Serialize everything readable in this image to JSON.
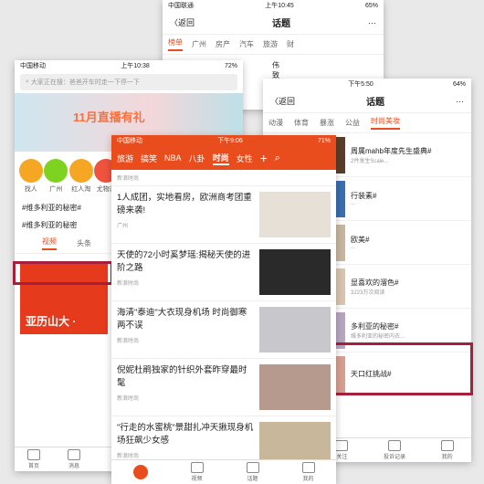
{
  "phone_back": {
    "status": {
      "carrier": "中国联通",
      "time": "上午10:45",
      "battery": "65%"
    },
    "nav": {
      "back": "〈返回",
      "title": "话题",
      "more": "···"
    },
    "tabs": [
      "榜单",
      "广州",
      "房产",
      "汽车",
      "旅游",
      "财"
    ],
    "preview": "伟致11  作日投年"
  },
  "phone_right": {
    "status": {
      "carrier": "",
      "time": "下午5:50",
      "battery": "64%"
    },
    "nav": {
      "back": "〈返回",
      "title": "话题",
      "more": "···"
    },
    "tabs": [
      "动漫",
      "体育",
      "暴涨",
      "公益",
      "时尚美妆"
    ],
    "items": [
      {
        "title": "周属mahb年度先生盛典#",
        "sub": "2件发生Scale..."
      },
      {
        "title": "行装素#",
        "sub": "..."
      },
      {
        "title": "欧美#",
        "sub": "..."
      },
      {
        "title": "显喜欢的溜色#",
        "sub": "3223万次阅读"
      },
      {
        "title": "多利亚的秘密#",
        "sub": "维多利亚的秘密内衣..."
      },
      {
        "title": "天口红挑战#",
        "sub": ""
      }
    ],
    "tabbar": [
      "关注",
      "投诉记录",
      "我的"
    ]
  },
  "phone_left": {
    "status": {
      "carrier": "中国移动",
      "time": "上午10:38",
      "battery": "72%"
    },
    "search_placeholder": "大家正在搜：爸爸开车时走一下停一下",
    "banner_text": "11月直播有礼",
    "icons": [
      {
        "label": "找人",
        "color": "#f5a623"
      },
      {
        "label": "广州",
        "color": "#7ed321"
      },
      {
        "label": "红人淘",
        "color": "#f5a623"
      },
      {
        "label": "尤物志",
        "color": "#f0533d"
      }
    ],
    "topics": [
      "#维多利亚的秘密#",
      "#维多利亚的秘密"
    ],
    "tabs": [
      "视频",
      "头条"
    ],
    "video_title": "亚历山大 ·",
    "tabbar": [
      "首页",
      "消息"
    ]
  },
  "phone_front": {
    "status": {
      "carrier": "中国移动",
      "time": "下午9:06",
      "battery": "71%"
    },
    "tabs": [
      "旅游",
      "搞笑",
      "NBA",
      "八卦",
      "时尚",
      "女性"
    ],
    "news": [
      {
        "title": "1人成团，实地看房，欧洲商考团重磅来袭!",
        "meta": "广州",
        "img": "#e6e0d6"
      },
      {
        "title": "天使的72小时奚梦瑶:揭秘天使的进阶之路",
        "meta": "新浪时尚",
        "img": "#2a2a2a"
      },
      {
        "title": "海清\"泰迪\"大衣现身机场 时尚御寒两不误",
        "meta": "新浪时尚",
        "img": "#c8c8cc"
      },
      {
        "title": "倪妮杜鹃独家的针织外套昨穿最时髦",
        "meta": "新浪时尚",
        "img": "#b59a8d"
      },
      {
        "title": "\"行走的水蜜桃\"景甜扎冲天揪现身机场狂飙少女感",
        "meta": "新浪时尚",
        "img": "#c9b79c"
      }
    ],
    "top_meta": "新浪时尚",
    "tabbar": [
      "",
      "视频",
      "话题",
      "我的"
    ]
  }
}
